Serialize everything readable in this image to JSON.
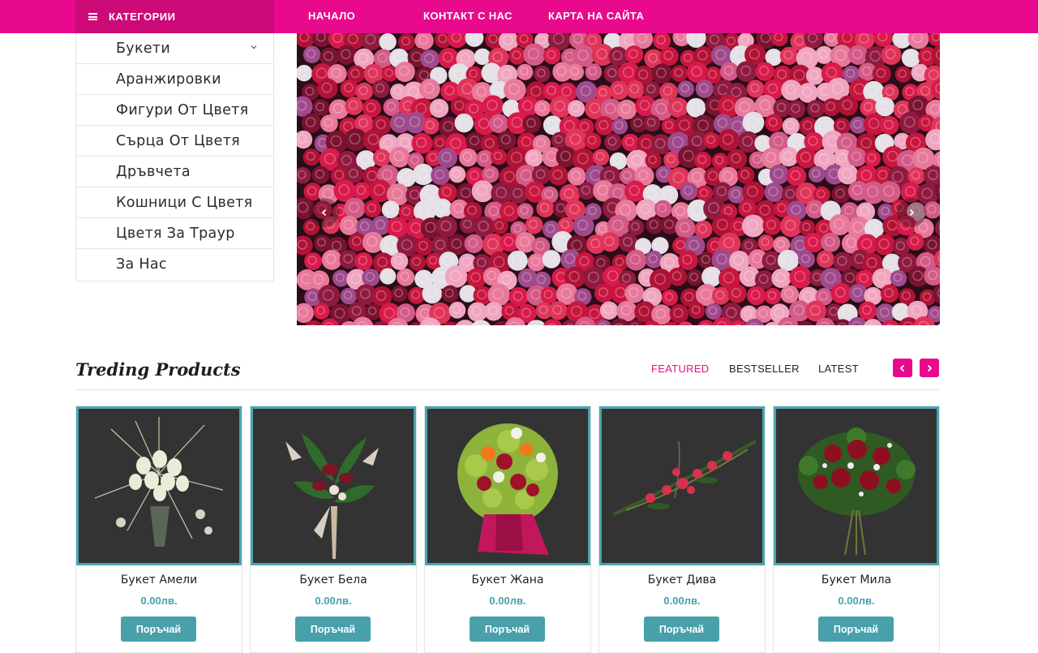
{
  "nav": {
    "categories_label": "КАТЕГОРИИ",
    "links": [
      "НАЧАЛО",
      "КОНТАКТ С НАС",
      "КАРТА НА САЙТА"
    ]
  },
  "sidebar": {
    "items": [
      {
        "label": "Букети"
      },
      {
        "label": "Аранжировки"
      },
      {
        "label": "Фигури От Цветя"
      },
      {
        "label": "Сърца От Цветя"
      },
      {
        "label": "Дръвчета"
      },
      {
        "label": "Кошници С Цветя"
      },
      {
        "label": "Цветя За Траур"
      },
      {
        "label": "За Нас"
      }
    ]
  },
  "trending": {
    "title": "Treding Products",
    "tabs": [
      "FEATURED",
      "BESTSELLER",
      "LATEST"
    ],
    "active_tab": "FEATURED"
  },
  "products": [
    {
      "name": "Букет Амели",
      "price": "0.00лв.",
      "button": "Поръчай"
    },
    {
      "name": "Букет Бела",
      "price": "0.00лв.",
      "button": "Поръчай"
    },
    {
      "name": "Букет Жана",
      "price": "0.00лв.",
      "button": "Поръчай"
    },
    {
      "name": "Букет Дива",
      "price": "0.00лв.",
      "button": "Поръчай"
    },
    {
      "name": "Букет Мила",
      "price": "0.00лв.",
      "button": "Поръчай"
    }
  ],
  "colors": {
    "brand_pink": "#e8098c",
    "brand_pink_dark": "#cc0a77",
    "accent_teal": "#48a0ab"
  }
}
